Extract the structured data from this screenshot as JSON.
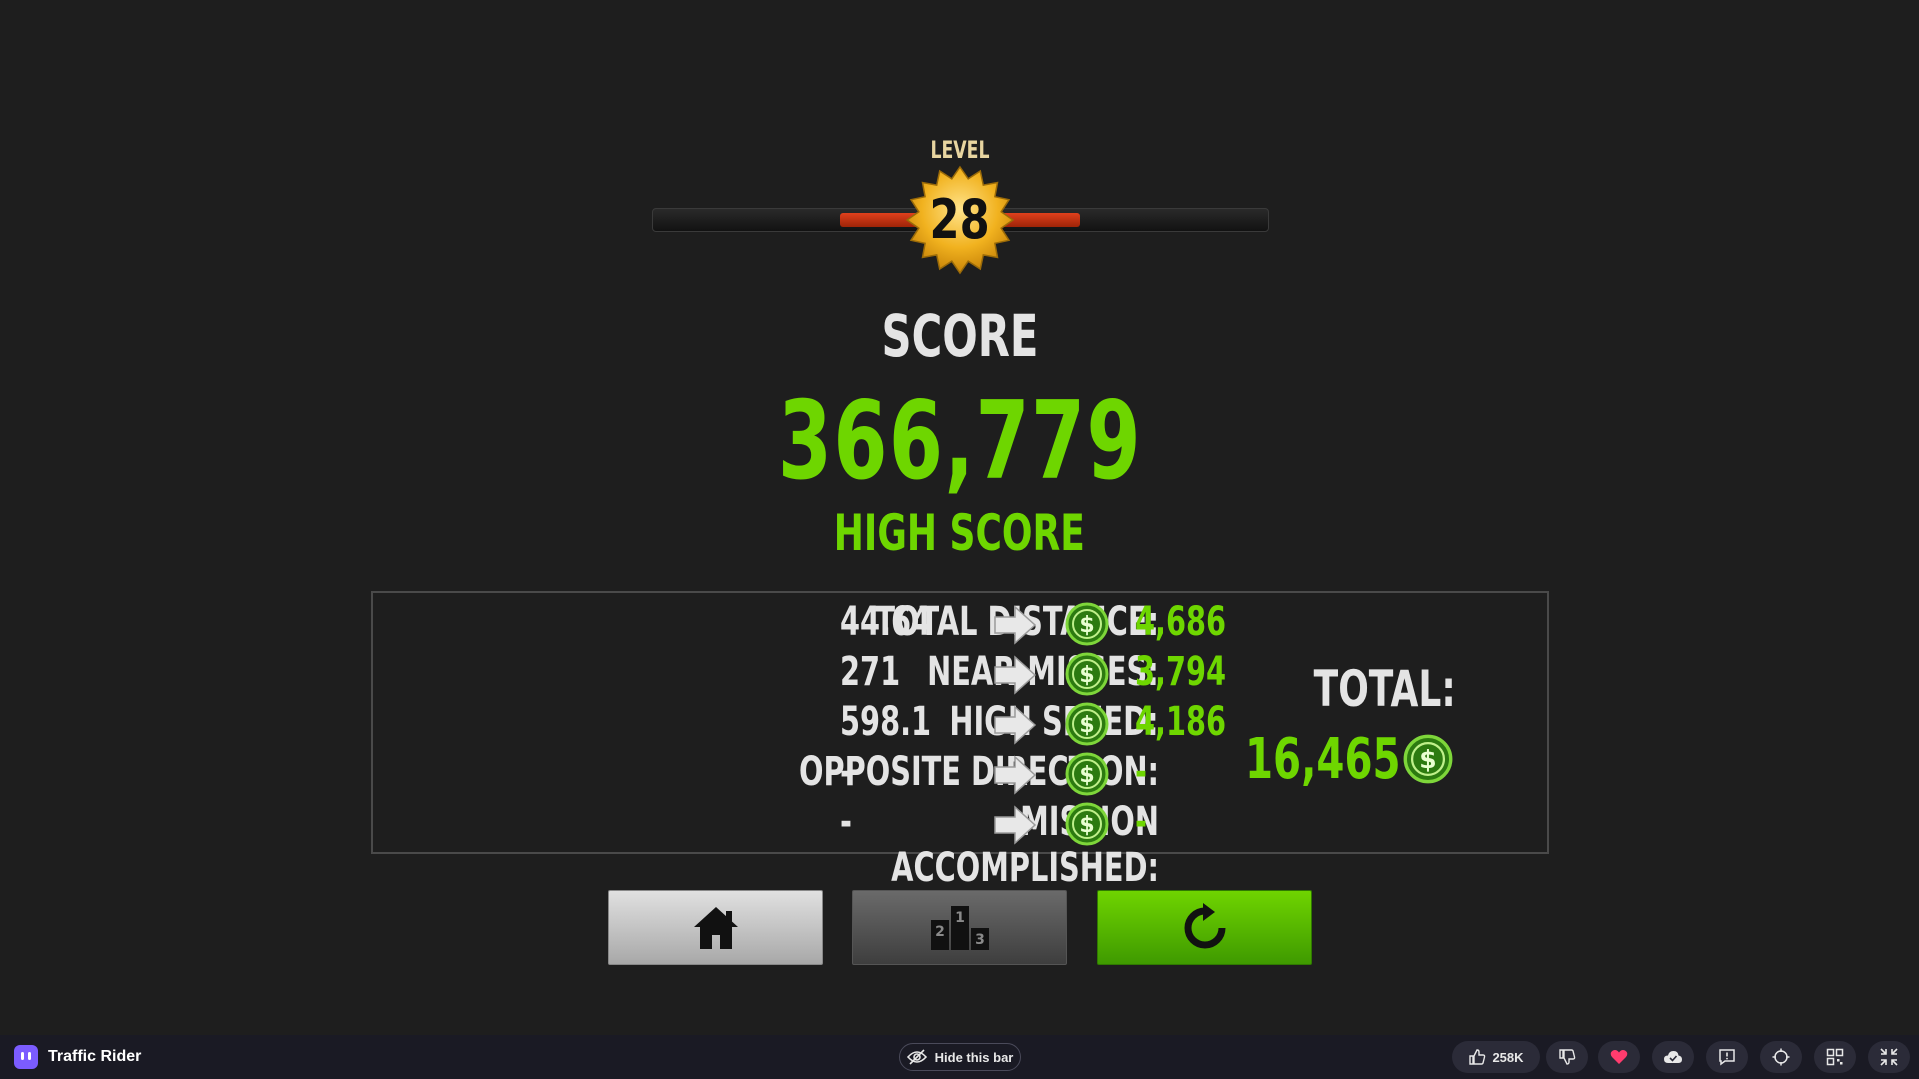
{
  "level": {
    "label": "LEVEL",
    "number": "28",
    "progress": 0.39
  },
  "score": {
    "title": "SCORE",
    "value": "366,779",
    "high_score_label": "HIGH SCORE"
  },
  "stats": [
    {
      "label": "TOTAL DISTANCE:",
      "value": "44.64",
      "reward": "4,686"
    },
    {
      "label": "NEAR-MISSES:",
      "value": "271",
      "reward": "3,794"
    },
    {
      "label": "HIGH SPEED:",
      "value": "598.1",
      "reward": "4,186"
    },
    {
      "label": "OPPOSITE DIRECTION:",
      "value": "-",
      "reward": "-"
    },
    {
      "label": "MISSION ACCOMPLISHED:",
      "value": "-",
      "reward": "-"
    }
  ],
  "total": {
    "label": "TOTAL:",
    "value": "16,465"
  },
  "buttons": {
    "home_icon": "home-icon",
    "leaderboard_icon": "podium-icon",
    "retry_icon": "restart-icon"
  },
  "bottom_bar": {
    "game_title": "Traffic Rider",
    "hide_label": "Hide this bar",
    "likes": "258K"
  },
  "colors": {
    "accent_green": "#6ed600",
    "level_fill": "#d8391a",
    "background": "#1e1e1e"
  }
}
